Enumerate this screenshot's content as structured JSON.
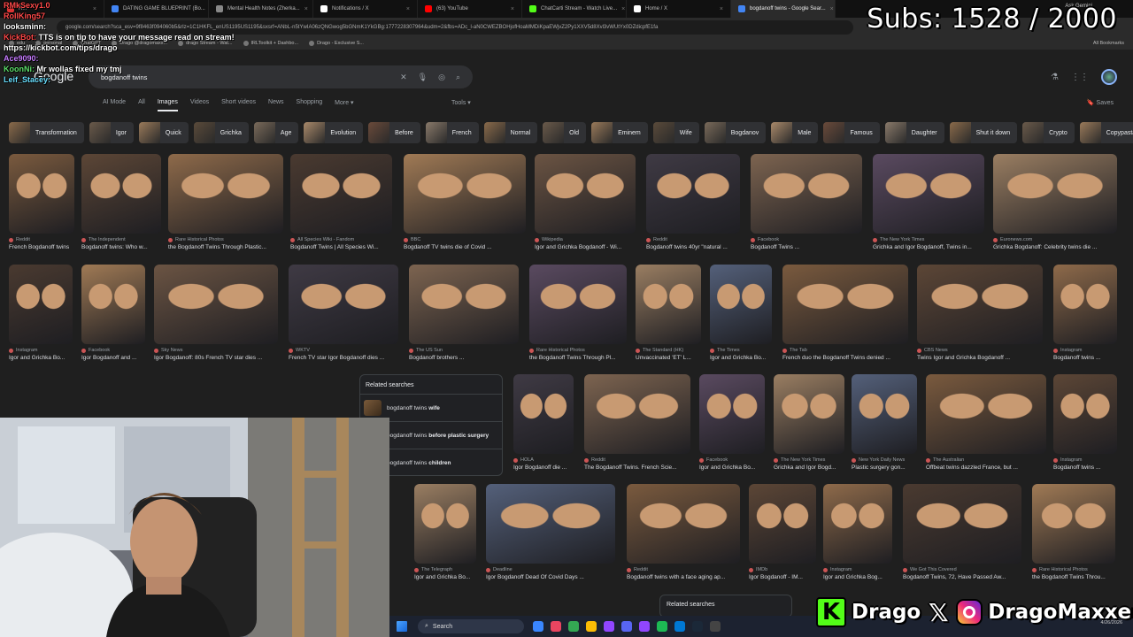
{
  "browser": {
    "tabs": [
      {
        "label": "R...",
        "color": "#d33"
      },
      {
        "label": "DATING GAME BLUEPRINT (Bo...",
        "color": "#4285f4"
      },
      {
        "label": "Mental Health Notes (Zherka...",
        "color": "#888"
      },
      {
        "label": "Notifications / X",
        "color": "#fff"
      },
      {
        "label": "(63) YouTube",
        "color": "#f00"
      },
      {
        "label": "ChatCarti Stream - Watch Live...",
        "color": "#53fc18"
      },
      {
        "label": "Home / X",
        "color": "#fff"
      },
      {
        "label": "bogdanoff twins - Google Sear...",
        "color": "#4285f4"
      }
    ],
    "url": "google.com/search?sca_esv=9f8463f094060b5&rlz=1C1HKFL_enUS1195US1195&sxsrf=ANbL-n5tYwIA06zQNGwog5bGNmK1YkGBg:1777228307964&udm=2&fbs=ADc_l-aN0CWEZBOHjofHoaMMDiKpaEWjvZ2Py1XXV5d8Xvl3vWUtYx0DZdicpfE1fa",
    "bookmarks": [
      "edu",
      "personal",
      "ChatGPT",
      "Drago @dragomaxx...",
      "drago Stream - Wat...",
      "IRLToolkit + Dashbo...",
      "Drago - Exclusive S..."
    ],
    "all_bookmarks": "All Bookmarks",
    "ask_gemini": "Ask Gemini"
  },
  "google": {
    "logo": "Google",
    "query": "bogdanoff twins",
    "nav_tabs": [
      "AI Mode",
      "All",
      "Images",
      "Videos",
      "Short videos",
      "News",
      "Shopping",
      "More ▾"
    ],
    "active_tab": "Images",
    "tools": "Tools ▾",
    "saves": "Saves",
    "chips": [
      "Transformation",
      "Igor",
      "Quick",
      "Grichka",
      "Age",
      "Evolution",
      "Before",
      "French",
      "Normal",
      "Old",
      "Eminem",
      "Wife",
      "Bogdanov",
      "Male",
      "Famous",
      "Daughter",
      "Shut it down",
      "Crypto",
      "Copypasta"
    ],
    "row1": [
      {
        "src": "Reddit",
        "title": "French Bogdanoff twins"
      },
      {
        "src": "The Independent",
        "title": "Bogdanoff twins: Who w..."
      },
      {
        "src": "Rare Historical Photos",
        "title": "the Bogdanoff Twins Through Plastic..."
      },
      {
        "src": "All Species Wiki - Fandom",
        "title": "Bogdanoff Twins | All Species Wi..."
      },
      {
        "src": "BBC",
        "title": "Bogdanoff TV twins die of Covid ..."
      },
      {
        "src": "Wikipedia",
        "title": "Igor and Grichka Bogdanoff - Wi..."
      },
      {
        "src": "Reddit",
        "title": "Bogdanoff twins 40yr \"natural ..."
      },
      {
        "src": "Facebook",
        "title": "Bogdanoff Twins ..."
      },
      {
        "src": "The New York Times",
        "title": "Grichka and Igor Bogdanoff, Twins in..."
      },
      {
        "src": "Euronews.com",
        "title": "Grichka Bogdanoff: Celebrity twins die ..."
      }
    ],
    "row2": [
      {
        "src": "Instagram",
        "title": "Igor and Grichka Bo..."
      },
      {
        "src": "Facebook",
        "title": "Igor Bogdanoff and ..."
      },
      {
        "src": "Sky News",
        "title": "Igor Bogdanoff: 80s French TV star dies ..."
      },
      {
        "src": "WKTV",
        "title": "French TV star Igor Bogdanoff dies ..."
      },
      {
        "src": "The US Sun",
        "title": "Bogdanoff brothers ..."
      },
      {
        "src": "Rare Historical Photos",
        "title": "the Bogdanoff Twins Through Pl..."
      },
      {
        "src": "The Standard (HK)",
        "title": "Unvaccinated 'ET' L..."
      },
      {
        "src": "The Times",
        "title": "Igor and Grichka Bo..."
      },
      {
        "src": "The Tab",
        "title": "French duo the Bogdanoff Twins denied ..."
      },
      {
        "src": "CBS News",
        "title": "Twins Igor and Grichka Bogdanoff ..."
      },
      {
        "src": "Instagram",
        "title": "Bogdanoff twins ..."
      }
    ],
    "row3": [
      {
        "src": "HOLA",
        "title": "Igor Bogdanoff die ..."
      },
      {
        "src": "Reddit",
        "title": "The Bogdanoff Twins. French Scie..."
      },
      {
        "src": "Facebook",
        "title": "Igor and Grichka Bo..."
      },
      {
        "src": "The New York Times",
        "title": "Grichka and Igor Bogd..."
      },
      {
        "src": "New York Daily News",
        "title": "Plastic surgery gon..."
      },
      {
        "src": "The Australian",
        "title": "Offbeat twins dazzled France, but ..."
      },
      {
        "src": "Instagram",
        "title": "Bogdanoff twins ..."
      }
    ],
    "row4": [
      {
        "src": "The Telegraph",
        "title": "Igor and Grichka Bo..."
      },
      {
        "src": "Deadline",
        "title": "Igor Bogdanoff Dead Of Covid Days ..."
      },
      {
        "src": "Reddit",
        "title": "Bogdanoff twins with a face aging ap..."
      },
      {
        "src": "IMDb",
        "title": "Igor Bogdanoff - IM..."
      },
      {
        "src": "Instagram",
        "title": "Igor and Grichka Bog..."
      },
      {
        "src": "We Got This Covered",
        "title": "Bogdanoff Twins, 72, Have Passed Aw..."
      },
      {
        "src": "Rare Historical Photos",
        "title": "the Bogdanoff Twins Throu..."
      }
    ],
    "related_title": "Related searches",
    "related": [
      {
        "prefix": "bogdanoff twins ",
        "bold": "wife"
      },
      {
        "prefix": "bogdanoff twins ",
        "bold": "before plastic surgery"
      },
      {
        "prefix": "bogdanoff twins ",
        "bold": "children"
      }
    ],
    "related2_title": "Related searches"
  },
  "taskbar": {
    "search": "Search",
    "time": "",
    "date": "4/26/2026"
  },
  "stream": {
    "subs": "Subs: 1528 / 2000",
    "chat": [
      {
        "user": "RMkSexy1.0",
        "cls": "u1",
        "msg": ""
      },
      {
        "user": "RollKing57",
        "cls": "u1",
        "msg": ""
      },
      {
        "user": "looksminn:",
        "cls": "u2",
        "msg": ""
      },
      {
        "user": "KickBot:",
        "cls": "u1",
        "msg": "TTS is on tip to have your message read on stream! https://kickbot.com/tips/drago"
      },
      {
        "user": "Ace9090:",
        "cls": "u4",
        "msg": ""
      },
      {
        "user": "KoonNi:",
        "cls": "u5",
        "msg": "Mr wollas fixed my tmj"
      },
      {
        "user": "Leif_Stacey:",
        "cls": "u6",
        "msg": ""
      }
    ],
    "handle1": "Drago",
    "handle2": "DragoMaxxer"
  }
}
